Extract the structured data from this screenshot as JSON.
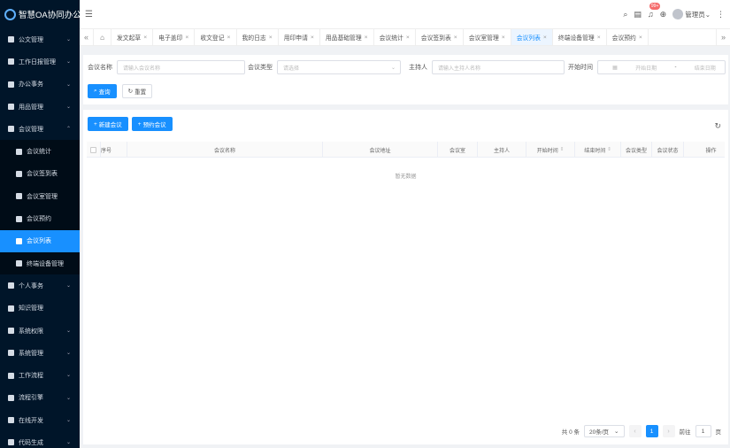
{
  "app": {
    "title": "智慧OA协同办公系统"
  },
  "sidebar": {
    "items": [
      {
        "label": "公文管理",
        "arrow": "⌄"
      },
      {
        "label": "工作日报管理",
        "arrow": "⌄"
      },
      {
        "label": "办公事务",
        "arrow": "⌄"
      },
      {
        "label": "用品管理",
        "arrow": "⌄"
      },
      {
        "label": "会议管理",
        "arrow": "⌃"
      },
      {
        "label": "会议统计"
      },
      {
        "label": "会议签到表"
      },
      {
        "label": "会议室管理"
      },
      {
        "label": "会议预约"
      },
      {
        "label": "会议列表"
      },
      {
        "label": "终端设备管理"
      },
      {
        "label": "个人事务",
        "arrow": "⌄"
      },
      {
        "label": "知识管理"
      },
      {
        "label": "系统权限",
        "arrow": "⌄"
      },
      {
        "label": "系统管理",
        "arrow": "⌄"
      },
      {
        "label": "工作流程",
        "arrow": "⌄"
      },
      {
        "label": "流程引擎",
        "arrow": "⌄"
      },
      {
        "label": "在线开发",
        "arrow": "⌄"
      },
      {
        "label": "代码生成",
        "arrow": "⌄"
      }
    ]
  },
  "header": {
    "badge": "99+",
    "user": "管理员",
    "user_caret": "⌄"
  },
  "tabs": {
    "items": [
      {
        "label": "发文起草"
      },
      {
        "label": "电子盖印"
      },
      {
        "label": "收文登记"
      },
      {
        "label": "我的日志"
      },
      {
        "label": "用印申请"
      },
      {
        "label": "用品基础管理"
      },
      {
        "label": "会议统计"
      },
      {
        "label": "会议签到表"
      },
      {
        "label": "会议室管理"
      },
      {
        "label": "会议列表"
      },
      {
        "label": "终端设备管理"
      },
      {
        "label": "会议预约"
      }
    ],
    "close": "×"
  },
  "search": {
    "name_label": "会议名称",
    "name_placeholder": "请输入会议名称",
    "type_label": "会议类型",
    "type_placeholder": "请选择",
    "host_label": "主持人",
    "host_placeholder": "请输入主持人名称",
    "time_label": "开始时间",
    "start_placeholder": "开始日期",
    "range_sep": "-",
    "end_placeholder": "结束日期",
    "query_label": "查询",
    "reset_label": "重置"
  },
  "toolbar": {
    "add_label": "新建会议",
    "reserve_label": "预约会议"
  },
  "table": {
    "columns": [
      "序号",
      "会议名称",
      "会议地址",
      "会议室",
      "主持人",
      "开始时间",
      "结束时间",
      "会议类型",
      "会议状态",
      "操作"
    ],
    "empty_text": "暂无数据"
  },
  "pagination": {
    "total": "共 0 条",
    "page_size": "20条/页",
    "current_page": "1",
    "goto_label": "前往",
    "goto_value": "1",
    "page_unit": "页"
  }
}
